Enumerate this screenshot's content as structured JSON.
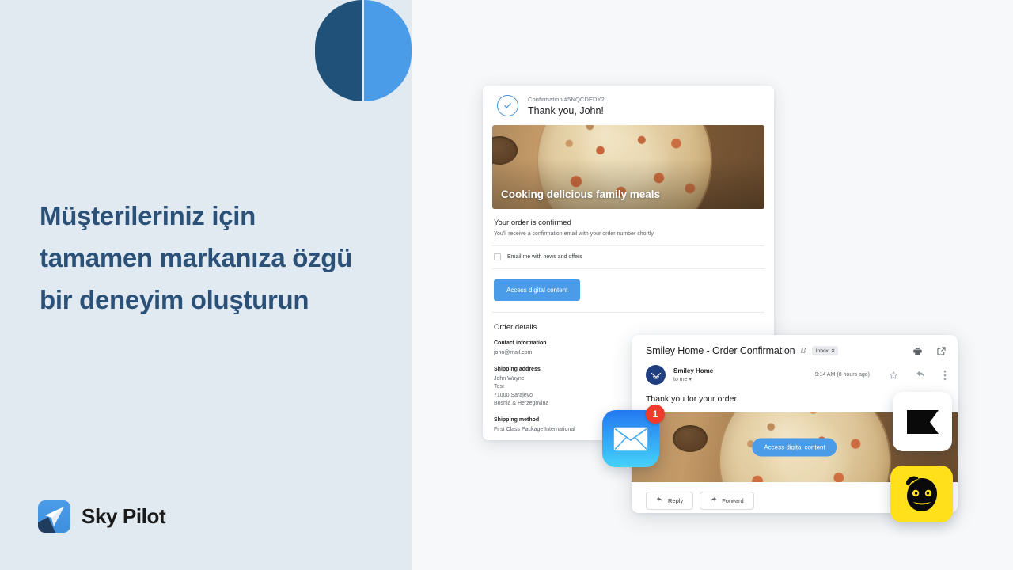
{
  "theme": {
    "panel_bg": "#E1EAF0",
    "stage_bg": "#F7F8F9",
    "headline_color": "#2C5179",
    "accent_blue": "#4A9BE8",
    "deco_dark": "#1F5179",
    "badge_red": "#EF3B2D",
    "mailchimp_yellow": "#FFE01B"
  },
  "left_panel": {
    "headline": "Müşterileriniz için tamamen markanıza özgü bir deneyim oluşturun",
    "brand_name": "Sky Pilot",
    "brand_mark_icon": "paper-plane-icon",
    "deco_dark_shape": "half-circle-dark",
    "deco_blue_shape": "half-circle-blue"
  },
  "email_card": {
    "check_icon": "check-circle-icon",
    "confirmation_label": "Confirmation #5NQCDEDY2",
    "thank_you": "Thank you, John!",
    "hero_caption": "Cooking delicious family meals",
    "hero_image_alt": "pizza-on-cutting-board",
    "order_confirmed_title": "Your order is confirmed",
    "order_confirmed_sub": "You'll receive a confirmation email with your order number shortly.",
    "newsletter_checkbox_label": "Email me with news and offers",
    "newsletter_checked": false,
    "cta_label": "Access digital content",
    "details_title": "Order details",
    "blocks": [
      {
        "heading": "Contact information",
        "lines": [
          "john@mail.com"
        ]
      },
      {
        "heading": "Shipping address",
        "lines": [
          "John Wayne",
          "Test",
          "71000 Sarajevo",
          "Bosnia & Herzegovina"
        ]
      },
      {
        "heading": "Shipping method",
        "lines": [
          "First Class Package International"
        ]
      }
    ]
  },
  "gmail_card": {
    "subject": "Smiley Home - Order Confirmation",
    "subject_badge_icon": "d-mark-icon",
    "inbox_chip": "Inbox",
    "inbox_chip_close_icon": "close-icon",
    "print_icon": "printer-icon",
    "popout_icon": "open-in-new-icon",
    "sender_avatar_icon": "smiley-home-logo-icon",
    "sender_name": "Smiley Home",
    "recipient": "to me",
    "recipient_caret_icon": "chevron-down-icon",
    "timestamp": "9:14 AM (8 hours ago)",
    "star_icon": "star-icon",
    "reply_icon": "reply-arrow-icon",
    "more_icon": "more-vert-icon",
    "body_text": "Thank you for your order!",
    "hero_image_alt": "pizza-on-cutting-board",
    "hero_cta_label": "Access digital content",
    "reply_button": "Reply",
    "forward_button": "Forward"
  },
  "floating_icons": {
    "mail": {
      "name": "apple-mail-icon",
      "badge_count": "1"
    },
    "klaviyo": {
      "name": "klaviyo-icon"
    },
    "mailchimp": {
      "name": "mailchimp-freddie-icon"
    }
  }
}
